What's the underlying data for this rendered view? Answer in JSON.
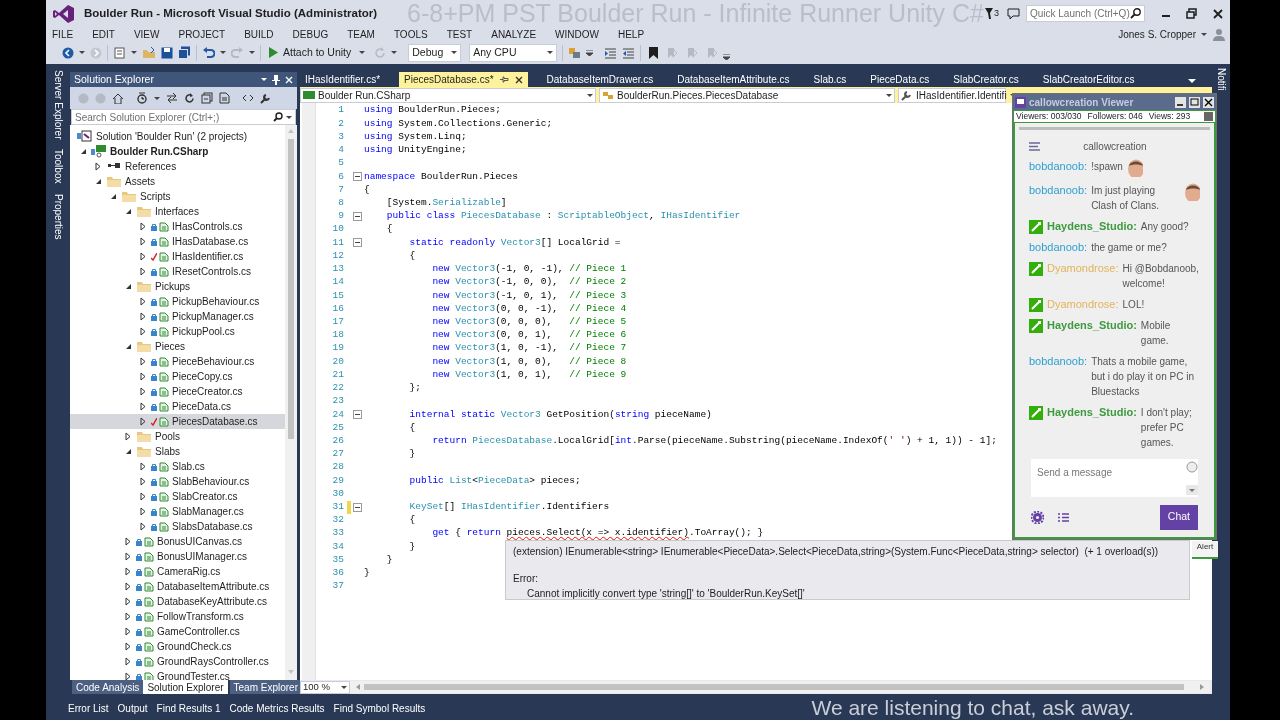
{
  "title_bar": {
    "title": "Boulder Run - Microsoft Visual Studio (Administrator)",
    "stream_overlay": "6-8+PM PST Boulder Run - Infinite Runner Unity C#",
    "notification_count": "3",
    "quick_launch": {
      "placeholder": "Quick Launch (Ctrl+Q)"
    }
  },
  "menu": [
    "FILE",
    "EDIT",
    "VIEW",
    "PROJECT",
    "BUILD",
    "DEBUG",
    "TEAM",
    "TOOLS",
    "TEST",
    "ANALYZE",
    "WINDOW",
    "HELP"
  ],
  "user": "Jones S. Cropper",
  "toolbar": {
    "run_button": "Attach to Unity",
    "configuration": "Debug",
    "platform": "Any CPU"
  },
  "side_tabs_left": [
    "Server Explorer",
    "Toolbox",
    "Properties"
  ],
  "side_tabs_right": [
    "Notifi"
  ],
  "solution_explorer": {
    "title": "Solution Explorer",
    "search": {
      "placeholder": "Search Solution Explorer (Ctrl+;)"
    },
    "tree": [
      {
        "label": "Solution 'Boulder Run' (2 projects)",
        "kind": "solution",
        "selected": false,
        "children": [
          {
            "label": "Boulder Run.CSharp",
            "kind": "project",
            "expanded": true,
            "selected": false,
            "children": [
              {
                "label": "References",
                "kind": "references",
                "expanded": false,
                "selected": false
              },
              {
                "label": "Assets",
                "kind": "folder",
                "expanded": true,
                "selected": false,
                "children": [
                  {
                    "label": "Scripts",
                    "kind": "folder",
                    "expanded": true,
                    "selected": false,
                    "children": [
                      {
                        "label": "Interfaces",
                        "kind": "folder",
                        "expanded": true,
                        "selected": false,
                        "children": [
                          {
                            "label": "IHasControls.cs",
                            "kind": "file",
                            "expanded": false,
                            "selected": false,
                            "edited": false
                          },
                          {
                            "label": "IHasDatabase.cs",
                            "kind": "file",
                            "expanded": false,
                            "selected": false,
                            "edited": false
                          },
                          {
                            "label": "IHasIdentifier.cs",
                            "kind": "file",
                            "expanded": false,
                            "selected": false,
                            "edited": true
                          },
                          {
                            "label": "IResetControls.cs",
                            "kind": "file",
                            "expanded": false,
                            "selected": false,
                            "edited": false
                          }
                        ]
                      },
                      {
                        "label": "Pickups",
                        "kind": "folder",
                        "expanded": true,
                        "selected": false,
                        "children": [
                          {
                            "label": "PickupBehaviour.cs",
                            "kind": "file",
                            "expanded": false,
                            "selected": false,
                            "edited": false
                          },
                          {
                            "label": "PickupManager.cs",
                            "kind": "file",
                            "expanded": false,
                            "selected": false,
                            "edited": false
                          },
                          {
                            "label": "PickupPool.cs",
                            "kind": "file",
                            "expanded": false,
                            "selected": false,
                            "edited": false
                          }
                        ]
                      },
                      {
                        "label": "Pieces",
                        "kind": "folder",
                        "expanded": true,
                        "selected": false,
                        "children": [
                          {
                            "label": "PieceBehaviour.cs",
                            "kind": "file",
                            "expanded": false,
                            "selected": false,
                            "edited": false
                          },
                          {
                            "label": "PieceCopy.cs",
                            "kind": "file",
                            "expanded": false,
                            "selected": false,
                            "edited": false
                          },
                          {
                            "label": "PieceCreator.cs",
                            "kind": "file",
                            "expanded": false,
                            "selected": false,
                            "edited": false
                          },
                          {
                            "label": "PieceData.cs",
                            "kind": "file",
                            "expanded": false,
                            "selected": false,
                            "edited": false
                          },
                          {
                            "label": "PiecesDatabase.cs",
                            "kind": "file",
                            "expanded": false,
                            "selected": true,
                            "edited": true
                          }
                        ]
                      },
                      {
                        "label": "Pools",
                        "kind": "folder",
                        "expanded": false,
                        "selected": false
                      },
                      {
                        "label": "Slabs",
                        "kind": "folder",
                        "expanded": true,
                        "selected": false,
                        "children": [
                          {
                            "label": "Slab.cs",
                            "kind": "file",
                            "expanded": false,
                            "selected": false,
                            "edited": false
                          },
                          {
                            "label": "SlabBehaviour.cs",
                            "kind": "file",
                            "expanded": false,
                            "selected": false,
                            "edited": false
                          },
                          {
                            "label": "SlabCreator.cs",
                            "kind": "file",
                            "expanded": false,
                            "selected": false,
                            "edited": false
                          },
                          {
                            "label": "SlabManager.cs",
                            "kind": "file",
                            "expanded": false,
                            "selected": false,
                            "edited": false
                          },
                          {
                            "label": "SlabsDatabase.cs",
                            "kind": "file",
                            "expanded": false,
                            "selected": false,
                            "edited": false
                          }
                        ]
                      },
                      {
                        "label": "BonusUICanvas.cs",
                        "kind": "file",
                        "expanded": false,
                        "selected": false,
                        "edited": false
                      },
                      {
                        "label": "BonusUIManager.cs",
                        "kind": "file",
                        "expanded": false,
                        "selected": false,
                        "edited": false
                      },
                      {
                        "label": "CameraRig.cs",
                        "kind": "file",
                        "expanded": false,
                        "selected": false,
                        "edited": false
                      },
                      {
                        "label": "DatabaseItemAttribute.cs",
                        "kind": "file",
                        "expanded": false,
                        "selected": false,
                        "edited": false
                      },
                      {
                        "label": "DatabaseKeyAttribute.cs",
                        "kind": "file",
                        "expanded": false,
                        "selected": false,
                        "edited": false
                      },
                      {
                        "label": "FollowTransform.cs",
                        "kind": "file",
                        "expanded": false,
                        "selected": false,
                        "edited": false
                      },
                      {
                        "label": "GameController.cs",
                        "kind": "file",
                        "expanded": false,
                        "selected": false,
                        "edited": false
                      },
                      {
                        "label": "GroundCheck.cs",
                        "kind": "file",
                        "expanded": false,
                        "selected": false,
                        "edited": false
                      },
                      {
                        "label": "GroundRaysController.cs",
                        "kind": "file",
                        "expanded": false,
                        "selected": false,
                        "edited": false
                      },
                      {
                        "label": "GroundTester.cs",
                        "kind": "file",
                        "expanded": false,
                        "selected": false,
                        "edited": false
                      }
                    ]
                  }
                ]
              }
            ]
          }
        ]
      }
    ],
    "bottom_tabs": [
      {
        "label": "Code Analysis",
        "selected": false
      },
      {
        "label": "Solution Explorer",
        "selected": true
      },
      {
        "label": "Team Explorer",
        "selected": false
      }
    ]
  },
  "editor": {
    "tabs": [
      {
        "label": "IHasIdentifier.cs*",
        "selected": false
      },
      {
        "label": "PiecesDatabase.cs*",
        "selected": true
      },
      {
        "label": "DatabaseItemDrawer.cs",
        "selected": false
      },
      {
        "label": "DatabaseItemAttribute.cs",
        "selected": false
      },
      {
        "label": "Slab.cs",
        "selected": false
      },
      {
        "label": "PieceData.cs",
        "selected": false
      },
      {
        "label": "SlabCreator.cs",
        "selected": false
      },
      {
        "label": "SlabCreatorEditor.cs",
        "selected": false
      }
    ],
    "nav": [
      "Boulder Run.CSharp",
      "BoulderRun.Pieces.PiecesDatabase",
      "IHasIdentifier.Identifi"
    ],
    "lines": [
      {
        "number": "1",
        "collapsible": false,
        "modified": false,
        "tokens": [
          {
            "kind": "keyword",
            "text": "using"
          },
          {
            "kind": "plain",
            "text": " BoulderRun.Pieces;"
          }
        ]
      },
      {
        "number": "2",
        "collapsible": false,
        "modified": false,
        "tokens": [
          {
            "kind": "keyword",
            "text": "using"
          },
          {
            "kind": "plain",
            "text": " System.Collections.Generic;"
          }
        ]
      },
      {
        "number": "3",
        "collapsible": false,
        "modified": false,
        "tokens": [
          {
            "kind": "keyword",
            "text": "using"
          },
          {
            "kind": "plain",
            "text": " System.Linq;"
          }
        ]
      },
      {
        "number": "4",
        "collapsible": false,
        "modified": false,
        "tokens": [
          {
            "kind": "keyword",
            "text": "using"
          },
          {
            "kind": "plain",
            "text": " UnityEngine;"
          }
        ]
      },
      {
        "number": "5",
        "collapsible": false,
        "modified": false
      },
      {
        "number": "6",
        "collapsible": true,
        "modified": false,
        "tokens": [
          {
            "kind": "keyword",
            "text": "namespace"
          },
          {
            "kind": "plain",
            "text": " BoulderRun.Pieces"
          }
        ]
      },
      {
        "number": "7",
        "collapsible": false,
        "modified": false,
        "tokens": [
          {
            "kind": "plain",
            "text": "{"
          }
        ]
      },
      {
        "number": "8",
        "collapsible": false,
        "modified": false,
        "tokens": [
          {
            "kind": "plain",
            "text": "    [System."
          },
          {
            "kind": "type",
            "text": "Serializable"
          },
          {
            "kind": "plain",
            "text": "]"
          }
        ]
      },
      {
        "number": "9",
        "collapsible": true,
        "modified": false,
        "tokens": [
          {
            "kind": "keyword",
            "text": "    public class "
          },
          {
            "kind": "type",
            "text": "PiecesDatabase"
          },
          {
            "kind": "plain",
            "text": " : "
          },
          {
            "kind": "type",
            "text": "ScriptableObject"
          },
          {
            "kind": "plain",
            "text": ", "
          },
          {
            "kind": "type",
            "text": "IHasIdentifier"
          }
        ]
      },
      {
        "number": "10",
        "collapsible": false,
        "modified": false,
        "tokens": [
          {
            "kind": "plain",
            "text": "    {"
          }
        ]
      },
      {
        "number": "11",
        "collapsible": true,
        "modified": false,
        "tokens": [
          {
            "kind": "keyword",
            "text": "        static readonly "
          },
          {
            "kind": "type",
            "text": "Vector3"
          },
          {
            "kind": "plain",
            "text": "[] LocalGrid ="
          }
        ]
      },
      {
        "number": "12",
        "collapsible": false,
        "modified": false,
        "tokens": [
          {
            "kind": "plain",
            "text": "        {"
          }
        ]
      },
      {
        "number": "13",
        "collapsible": false,
        "modified": false,
        "tokens": [
          {
            "kind": "keyword",
            "text": "            new "
          },
          {
            "kind": "type",
            "text": "Vector3"
          },
          {
            "kind": "plain",
            "text": "(-1, 0, -1), "
          },
          {
            "kind": "comment",
            "text": "// Piece 1"
          }
        ]
      },
      {
        "number": "14",
        "collapsible": false,
        "modified": false,
        "tokens": [
          {
            "kind": "keyword",
            "text": "            new "
          },
          {
            "kind": "type",
            "text": "Vector3"
          },
          {
            "kind": "plain",
            "text": "(-1, 0, 0),  "
          },
          {
            "kind": "comment",
            "text": "// Piece 2"
          }
        ]
      },
      {
        "number": "15",
        "collapsible": false,
        "modified": false,
        "tokens": [
          {
            "kind": "keyword",
            "text": "            new "
          },
          {
            "kind": "type",
            "text": "Vector3"
          },
          {
            "kind": "plain",
            "text": "(-1, 0, 1),  "
          },
          {
            "kind": "comment",
            "text": "// Piece 3"
          }
        ]
      },
      {
        "number": "16",
        "collapsible": false,
        "modified": false,
        "tokens": [
          {
            "kind": "keyword",
            "text": "            new "
          },
          {
            "kind": "type",
            "text": "Vector3"
          },
          {
            "kind": "plain",
            "text": "(0, 0, -1),  "
          },
          {
            "kind": "comment",
            "text": "// Piece 4"
          }
        ]
      },
      {
        "number": "17",
        "collapsible": false,
        "modified": false,
        "tokens": [
          {
            "kind": "keyword",
            "text": "            new "
          },
          {
            "kind": "type",
            "text": "Vector3"
          },
          {
            "kind": "plain",
            "text": "(0, 0, 0),   "
          },
          {
            "kind": "comment",
            "text": "// Piece 5"
          }
        ]
      },
      {
        "number": "18",
        "collapsible": false,
        "modified": false,
        "tokens": [
          {
            "kind": "keyword",
            "text": "            new "
          },
          {
            "kind": "type",
            "text": "Vector3"
          },
          {
            "kind": "plain",
            "text": "(0, 0, 1),   "
          },
          {
            "kind": "comment",
            "text": "// Piece 6"
          }
        ]
      },
      {
        "number": "19",
        "collapsible": false,
        "modified": false,
        "tokens": [
          {
            "kind": "keyword",
            "text": "            new "
          },
          {
            "kind": "type",
            "text": "Vector3"
          },
          {
            "kind": "plain",
            "text": "(1, 0, -1),  "
          },
          {
            "kind": "comment",
            "text": "// Piece 7"
          }
        ]
      },
      {
        "number": "20",
        "collapsible": false,
        "modified": false,
        "tokens": [
          {
            "kind": "keyword",
            "text": "            new "
          },
          {
            "kind": "type",
            "text": "Vector3"
          },
          {
            "kind": "plain",
            "text": "(1, 0, 0),   "
          },
          {
            "kind": "comment",
            "text": "// Piece 8"
          }
        ]
      },
      {
        "number": "21",
        "collapsible": false,
        "modified": false,
        "tokens": [
          {
            "kind": "keyword",
            "text": "            new "
          },
          {
            "kind": "type",
            "text": "Vector3"
          },
          {
            "kind": "plain",
            "text": "(1, 0, 1),   "
          },
          {
            "kind": "comment",
            "text": "// Piece 9"
          }
        ]
      },
      {
        "number": "22",
        "collapsible": false,
        "modified": false,
        "tokens": [
          {
            "kind": "plain",
            "text": "        };"
          }
        ]
      },
      {
        "number": "23",
        "collapsible": false,
        "modified": false
      },
      {
        "number": "24",
        "collapsible": true,
        "modified": false,
        "tokens": [
          {
            "kind": "keyword",
            "text": "        internal static "
          },
          {
            "kind": "type",
            "text": "Vector3"
          },
          {
            "kind": "plain",
            "text": " GetPosition("
          },
          {
            "kind": "keyword",
            "text": "string"
          },
          {
            "kind": "plain",
            "text": " pieceName)"
          }
        ]
      },
      {
        "number": "25",
        "collapsible": false,
        "modified": false,
        "tokens": [
          {
            "kind": "plain",
            "text": "        {"
          }
        ]
      },
      {
        "number": "26",
        "collapsible": false,
        "modified": false,
        "tokens": [
          {
            "kind": "keyword",
            "text": "            return "
          },
          {
            "kind": "type",
            "text": "PiecesDatabase"
          },
          {
            "kind": "plain",
            "text": ".LocalGrid["
          },
          {
            "kind": "keyword",
            "text": "int"
          },
          {
            "kind": "plain",
            "text": ".Parse(pieceName.Substring(pieceName.IndexOf("
          },
          {
            "kind": "string",
            "text": "' '"
          },
          {
            "kind": "plain",
            "text": ") + 1, 1)) - 1];"
          }
        ]
      },
      {
        "number": "27",
        "collapsible": false,
        "modified": false,
        "tokens": [
          {
            "kind": "plain",
            "text": "        }"
          }
        ]
      },
      {
        "number": "28",
        "collapsible": false,
        "modified": false
      },
      {
        "number": "29",
        "collapsible": false,
        "modified": false,
        "tokens": [
          {
            "kind": "keyword",
            "text": "        public "
          },
          {
            "kind": "type",
            "text": "List"
          },
          {
            "kind": "plain",
            "text": "<"
          },
          {
            "kind": "type",
            "text": "PieceData"
          },
          {
            "kind": "plain",
            "text": "> pieces;"
          }
        ]
      },
      {
        "number": "30",
        "collapsible": false,
        "modified": false
      },
      {
        "number": "31",
        "collapsible": true,
        "modified": true,
        "tokens": [
          {
            "kind": "type",
            "text": "        KeySet"
          },
          {
            "kind": "plain",
            "text": "[] "
          },
          {
            "kind": "type",
            "text": "IHasIdentifier"
          },
          {
            "kind": "plain",
            "text": ".Identifiers"
          }
        ]
      },
      {
        "number": "32",
        "collapsible": false,
        "modified": false,
        "tokens": [
          {
            "kind": "plain",
            "text": "        {"
          }
        ]
      },
      {
        "number": "33",
        "collapsible": false,
        "modified": false,
        "tokens": [
          {
            "kind": "keyword",
            "text": "            get"
          },
          {
            "kind": "plain",
            "text": " { "
          },
          {
            "kind": "keyword",
            "text": "return "
          },
          {
            "kind": "error",
            "text": "pieces.Select(x => x.identifier)"
          },
          {
            "kind": "plain",
            "text": ".ToArray(); }"
          }
        ]
      },
      {
        "number": "34",
        "collapsible": false,
        "modified": false,
        "tokens": [
          {
            "kind": "plain",
            "text": "        }"
          }
        ]
      },
      {
        "number": "35",
        "collapsible": false,
        "modified": false,
        "tokens": [
          {
            "kind": "plain",
            "text": "    }"
          }
        ]
      },
      {
        "number": "36",
        "collapsible": false,
        "modified": false,
        "tokens": [
          {
            "kind": "plain",
            "text": "}"
          }
        ]
      },
      {
        "number": "37",
        "collapsible": false,
        "modified": false
      }
    ],
    "zoom": "100 %",
    "tooltip": {
      "signature": "(extension) IEnumerable<string> IEnumerable<PieceData>.Select<PieceData,string>(System.Func<PieceData,string> selector)  (+ 1 overload(s))",
      "error_label": "Error:",
      "error_message": "Cannot implicitly convert type 'string[]' to 'BoulderRun.KeySet[]'"
    }
  },
  "chat": {
    "window_title": "callowcreation Viewer",
    "stats": [
      "Viewers: 003/030",
      "Followers: 046",
      "Views: 293"
    ],
    "channel": "callowcreation",
    "messages": [
      {
        "user": "bobdanoob:",
        "color": "#2f9fd0",
        "bold": false,
        "moderator": false,
        "text": "!spawn",
        "emote": true
      },
      {
        "user": "bobdanoob:",
        "color": "#2f9fd0",
        "bold": false,
        "moderator": false,
        "text": "Im just playing Clash of Clans.",
        "emote": true
      },
      {
        "user": "Haydens_Studio:",
        "color": "#3e9a3e",
        "bold": true,
        "moderator": true,
        "text": "Any good?",
        "emote": false
      },
      {
        "user": "bobdanoob:",
        "color": "#2f9fd0",
        "bold": false,
        "moderator": false,
        "text": "the game or me?",
        "emote": false
      },
      {
        "user": "Dyamondrose:",
        "color": "#e2b45a",
        "bold": false,
        "moderator": true,
        "text": "Hi @Bobdanoob, welcome!",
        "emote": false
      },
      {
        "user": "Dyamondrose:",
        "color": "#e2b45a",
        "bold": false,
        "moderator": true,
        "text": "LOL!",
        "emote": false
      },
      {
        "user": "Haydens_Studio:",
        "color": "#3e9a3e",
        "bold": true,
        "moderator": true,
        "text": "Mobile game.",
        "emote": false
      },
      {
        "user": "bobdanoob:",
        "color": "#2f9fd0",
        "bold": false,
        "moderator": false,
        "text": "Thats a mobile game, but i do play it on PC in Bluestacks",
        "emote": false
      },
      {
        "user": "Haydens_Studio:",
        "color": "#3e9a3e",
        "bold": true,
        "moderator": true,
        "text": "I don't play; prefer PC games.",
        "emote": false
      }
    ],
    "input": {
      "placeholder": "Send a message"
    },
    "send_button": "Chat",
    "behind_label": "Alert"
  },
  "bottom_tabs": [
    "Error List",
    "Output",
    "Find Results 1",
    "Code Metrics Results",
    "Find Symbol Results"
  ],
  "stream_caption": "We are listening to chat, ask away."
}
